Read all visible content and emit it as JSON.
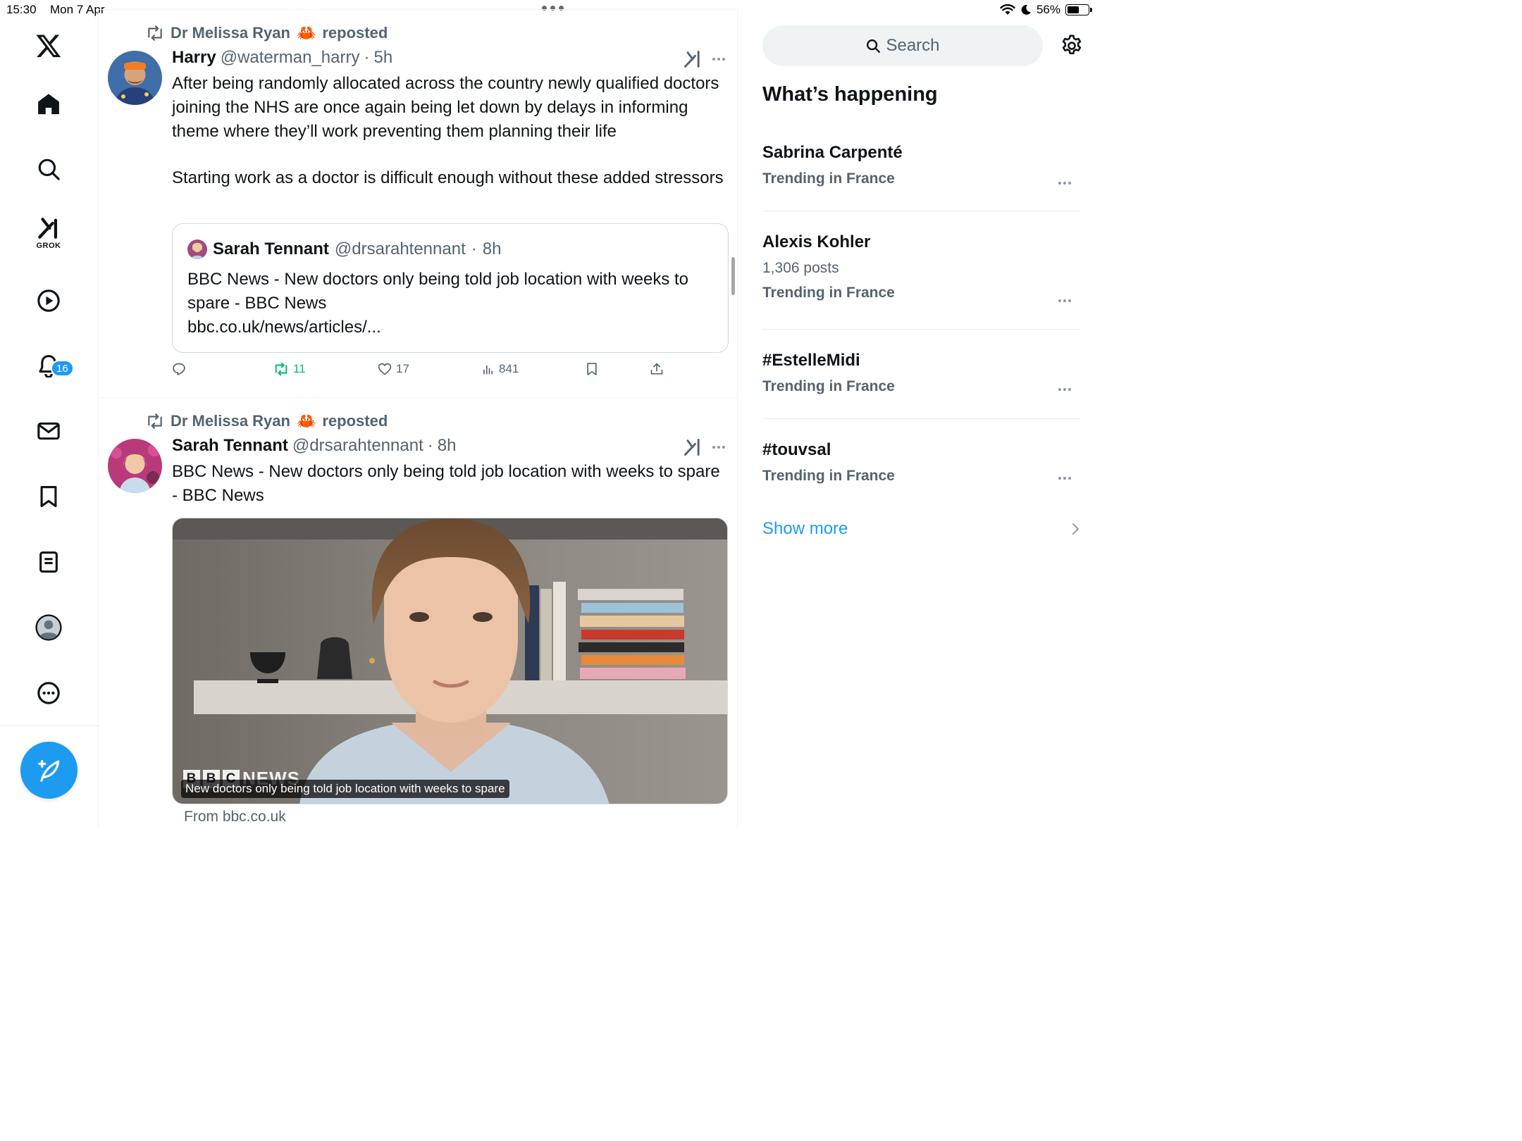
{
  "status_bar": {
    "time": "15:30",
    "date": "Mon 7 Apr",
    "battery": "56%"
  },
  "nav": {
    "grok_label": "GROK",
    "notifications_count": "16"
  },
  "tweets": [
    {
      "repost_by": "Dr Melissa Ryan",
      "repost_emoji": "🦀",
      "repost_suffix": "reposted",
      "author_name": "Harry",
      "author_handle": "@waterman_harry",
      "separator": "·",
      "time": "5h",
      "text_p1": "After being randomly allocated across the country newly qualified doctors joining the NHS are once again being let down by delays in informing theme where they’ll work preventing them planning their life",
      "text_p2": "Starting work as a doctor is difficult enough without these added stressors",
      "quote": {
        "author_name": "Sarah Tennant",
        "author_handle": "@drsarahtennant",
        "separator": "·",
        "time": "8h",
        "text_line1": "BBC News - New doctors only being told job location with weeks to spare - BBC News",
        "link": "bbc.co.uk/news/articles/..."
      },
      "actions": {
        "replies": "",
        "retweets": "11",
        "likes": "17",
        "views": "841"
      }
    },
    {
      "repost_by": "Dr Melissa Ryan",
      "repost_emoji": "🦀",
      "repost_suffix": "reposted",
      "author_name": "Sarah Tennant",
      "author_handle": "@drsarahtennant",
      "separator": "·",
      "time": "8h",
      "text": "BBC News - New doctors only being told job location with weeks to spare - BBC News",
      "media": {
        "logo_text": "NEWS",
        "logo_letters": [
          "B",
          "B",
          "C"
        ],
        "caption": "New doctors only being told job location with weeks to spare",
        "source": "From bbc.co.uk"
      }
    }
  ],
  "right": {
    "search_placeholder": "Search",
    "section_title": "What’s happening",
    "trends": [
      {
        "name": "Sabrina Carpenté",
        "meta": "",
        "context": "Trending in France"
      },
      {
        "name": "Alexis Kohler",
        "meta": "1,306 posts",
        "context": "Trending in France"
      },
      {
        "name": "#EstelleMidi",
        "meta": "",
        "context": "Trending in France"
      },
      {
        "name": "#touvsal",
        "meta": "",
        "context": "Trending in France"
      }
    ],
    "show_more": "Show more"
  },
  "colors": {
    "accent": "#1d9bf0",
    "retweet_green": "#00ba7c",
    "secondary_text": "#536471"
  }
}
